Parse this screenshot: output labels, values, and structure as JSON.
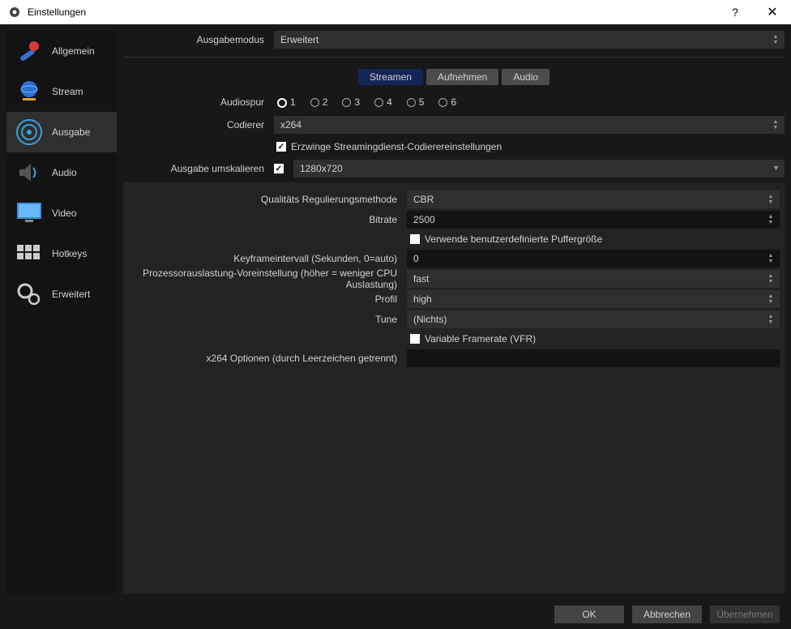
{
  "window": {
    "title": "Einstellungen"
  },
  "sidebar": {
    "items": [
      {
        "label": "Allgemein"
      },
      {
        "label": "Stream"
      },
      {
        "label": "Ausgabe"
      },
      {
        "label": "Audio"
      },
      {
        "label": "Video"
      },
      {
        "label": "Hotkeys"
      },
      {
        "label": "Erweitert"
      }
    ]
  },
  "output_mode": {
    "label": "Ausgabemodus",
    "value": "Erweitert"
  },
  "tabs": {
    "stream": "Streamen",
    "record": "Aufnehmen",
    "audio": "Audio"
  },
  "stream": {
    "audiotrack_label": "Audiospur",
    "tracks": [
      "1",
      "2",
      "3",
      "4",
      "5",
      "6"
    ],
    "selected_track": "1",
    "encoder_label": "Codierer",
    "encoder_value": "x264",
    "enforce_label": "Erzwinge Streamingdienst-Codierereinstellungen",
    "rescale_label": "Ausgabe umskalieren",
    "rescale_value": "1280x720"
  },
  "x264": {
    "rate_control_label": "Qualitäts Regulierungsmethode",
    "rate_control_value": "CBR",
    "bitrate_label": "Bitrate",
    "bitrate_value": "2500",
    "custom_buffer_label": "Verwende benutzerdefinierte Puffergröße",
    "keyframe_label": "Keyframeintervall (Sekunden, 0=auto)",
    "keyframe_value": "0",
    "preset_label": "Prozessorauslastung-Voreinstellung (höher = weniger CPU Auslastung)",
    "preset_value": "fast",
    "profile_label": "Profil",
    "profile_value": "high",
    "tune_label": "Tune",
    "tune_value": "(Nichts)",
    "vfr_label": "Variable Framerate (VFR)",
    "x264opts_label": "x264 Optionen (durch Leerzeichen getrennt)",
    "x264opts_value": ""
  },
  "footer": {
    "ok": "OK",
    "cancel": "Abbrechen",
    "apply": "Übernehmen"
  }
}
